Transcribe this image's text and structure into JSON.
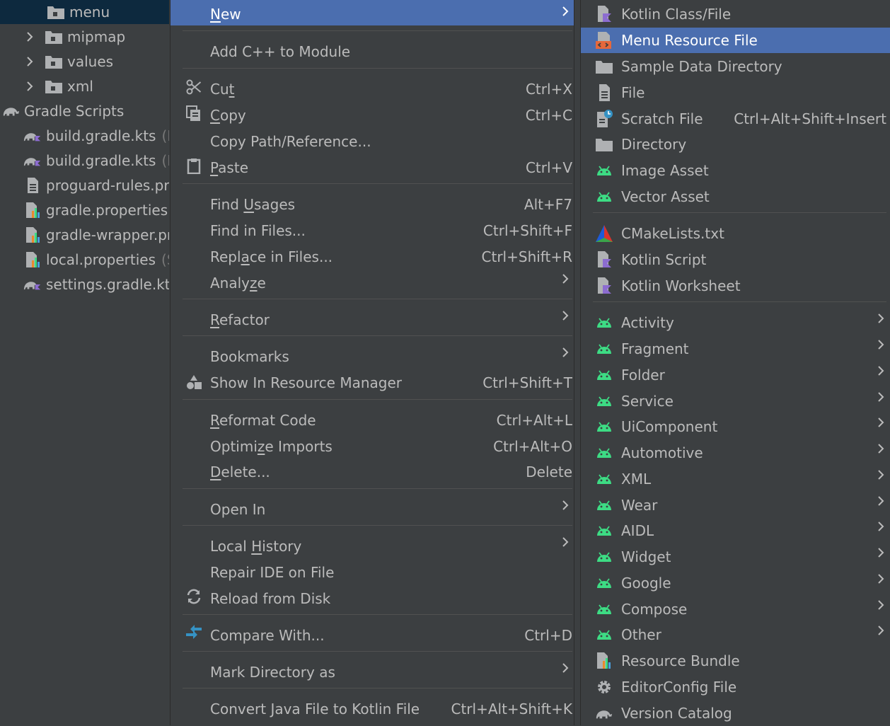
{
  "colors": {
    "background": "#3c3f41",
    "selection": "#4b6eaf",
    "tree_selection": "#0d293e",
    "separator": "#515151",
    "text": "#bbbbbb",
    "android_green": "#3ddc84",
    "kotlin_purple": "#8c6cd0"
  },
  "tree": {
    "items": [
      {
        "label": "menu",
        "hint": "",
        "icon": "folder-icon"
      },
      {
        "label": "mipmap",
        "hint": "",
        "icon": "folder-icon"
      },
      {
        "label": "values",
        "hint": "",
        "icon": "folder-icon"
      },
      {
        "label": "xml",
        "hint": "",
        "icon": "folder-icon"
      },
      {
        "label": "Gradle Scripts",
        "hint": "",
        "icon": "gradle-elephant-icon"
      },
      {
        "label": "build.gradle.kts",
        "hint": "(P",
        "icon": "gradle-kotlin-icon"
      },
      {
        "label": "build.gradle.kts",
        "hint": "(M",
        "icon": "gradle-kotlin-icon"
      },
      {
        "label": "proguard-rules.pro",
        "hint": "",
        "icon": "text-file-icon"
      },
      {
        "label": "gradle.properties",
        "hint": "(",
        "icon": "properties-icon"
      },
      {
        "label": "gradle-wrapper.pr",
        "hint": "",
        "icon": "properties-icon"
      },
      {
        "label": "local.properties",
        "hint": "(SI",
        "icon": "properties-icon"
      },
      {
        "label": "settings.gradle.kts",
        "hint": "",
        "icon": "gradle-kotlin-icon"
      }
    ]
  },
  "main_menu": {
    "new": {
      "pre": "",
      "mn": "N",
      "post": "ew"
    },
    "add_cpp": "Add C++ to Module",
    "cut": {
      "pre": "Cu",
      "mn": "t",
      "post": "",
      "shortcut": "Ctrl+X"
    },
    "copy": {
      "pre": "",
      "mn": "C",
      "post": "opy",
      "shortcut": "Ctrl+C"
    },
    "copy_path": "Copy Path/Reference...",
    "paste": {
      "pre": "",
      "mn": "P",
      "post": "aste",
      "shortcut": "Ctrl+V"
    },
    "find_usages": {
      "pre": "Find ",
      "mn": "U",
      "post": "sages",
      "shortcut": "Alt+F7"
    },
    "find_in_files": {
      "label": "Find in Files...",
      "shortcut": "Ctrl+Shift+F"
    },
    "replace_in_files": {
      "pre": "Repl",
      "mn": "a",
      "post": "ce in Files...",
      "shortcut": "Ctrl+Shift+R"
    },
    "analyze": {
      "pre": "Analy",
      "mn": "z",
      "post": "e"
    },
    "refactor": {
      "pre": "",
      "mn": "R",
      "post": "efactor"
    },
    "bookmarks": "Bookmarks",
    "show_resource_manager": {
      "label": "Show In Resource Manager",
      "shortcut": "Ctrl+Shift+T"
    },
    "reformat_code": {
      "pre": "",
      "mn": "R",
      "post": "eformat Code",
      "shortcut": "Ctrl+Alt+L"
    },
    "optimize_imports": {
      "pre": "Optimi",
      "mn": "z",
      "post": "e Imports",
      "shortcut": "Ctrl+Alt+O"
    },
    "delete": {
      "pre": "",
      "mn": "D",
      "post": "elete...",
      "shortcut": "Delete"
    },
    "open_in": "Open In",
    "local_history": {
      "pre": "Local ",
      "mn": "H",
      "post": "istory"
    },
    "repair_ide": "Repair IDE on File",
    "reload_from_disk": "Reload from Disk",
    "compare_with": {
      "label": "Compare With...",
      "shortcut": "Ctrl+D"
    },
    "mark_directory": "Mark Directory as",
    "convert_java": {
      "label": "Convert Java File to Kotlin File",
      "shortcut": "Ctrl+Alt+Shift+K"
    }
  },
  "sub_menu": {
    "items": [
      {
        "label": "Kotlin Class/File",
        "icon": "kotlin-file-icon",
        "shortcut": "",
        "submenu": false
      },
      {
        "label": "Menu Resource File",
        "icon": "menu-resource-icon",
        "shortcut": "",
        "submenu": false
      },
      {
        "label": "Sample Data Directory",
        "icon": "folder-icon",
        "shortcut": "",
        "submenu": false
      },
      {
        "label": "File",
        "icon": "file-icon",
        "shortcut": "",
        "submenu": false
      },
      {
        "label": "Scratch File",
        "icon": "scratch-file-icon",
        "shortcut": "Ctrl+Alt+Shift+Insert",
        "submenu": false
      },
      {
        "label": "Directory",
        "icon": "folder-icon",
        "shortcut": "",
        "submenu": false
      },
      {
        "label": "Image Asset",
        "icon": "android-icon",
        "shortcut": "",
        "submenu": false
      },
      {
        "label": "Vector Asset",
        "icon": "android-icon",
        "shortcut": "",
        "submenu": false
      },
      {
        "label": "CMakeLists.txt",
        "icon": "cmake-icon",
        "shortcut": "",
        "submenu": false
      },
      {
        "label": "Kotlin Script",
        "icon": "kotlin-file-icon",
        "shortcut": "",
        "submenu": false
      },
      {
        "label": "Kotlin Worksheet",
        "icon": "kotlin-file-icon",
        "shortcut": "",
        "submenu": false
      },
      {
        "label": "Activity",
        "icon": "android-icon",
        "shortcut": "",
        "submenu": true
      },
      {
        "label": "Fragment",
        "icon": "android-icon",
        "shortcut": "",
        "submenu": true
      },
      {
        "label": "Folder",
        "icon": "android-icon",
        "shortcut": "",
        "submenu": true
      },
      {
        "label": "Service",
        "icon": "android-icon",
        "shortcut": "",
        "submenu": true
      },
      {
        "label": "UiComponent",
        "icon": "android-icon",
        "shortcut": "",
        "submenu": true
      },
      {
        "label": "Automotive",
        "icon": "android-icon",
        "shortcut": "",
        "submenu": true
      },
      {
        "label": "XML",
        "icon": "android-icon",
        "shortcut": "",
        "submenu": true
      },
      {
        "label": "Wear",
        "icon": "android-icon",
        "shortcut": "",
        "submenu": true
      },
      {
        "label": "AIDL",
        "icon": "android-icon",
        "shortcut": "",
        "submenu": true
      },
      {
        "label": "Widget",
        "icon": "android-icon",
        "shortcut": "",
        "submenu": true
      },
      {
        "label": "Google",
        "icon": "android-icon",
        "shortcut": "",
        "submenu": true
      },
      {
        "label": "Compose",
        "icon": "android-icon",
        "shortcut": "",
        "submenu": true
      },
      {
        "label": "Other",
        "icon": "android-icon",
        "shortcut": "",
        "submenu": true
      },
      {
        "label": "Resource Bundle",
        "icon": "properties-icon",
        "shortcut": "",
        "submenu": false
      },
      {
        "label": "EditorConfig File",
        "icon": "gear-icon",
        "shortcut": "",
        "submenu": false
      },
      {
        "label": "Version Catalog",
        "icon": "gradle-elephant-icon",
        "shortcut": "",
        "submenu": false
      }
    ]
  }
}
